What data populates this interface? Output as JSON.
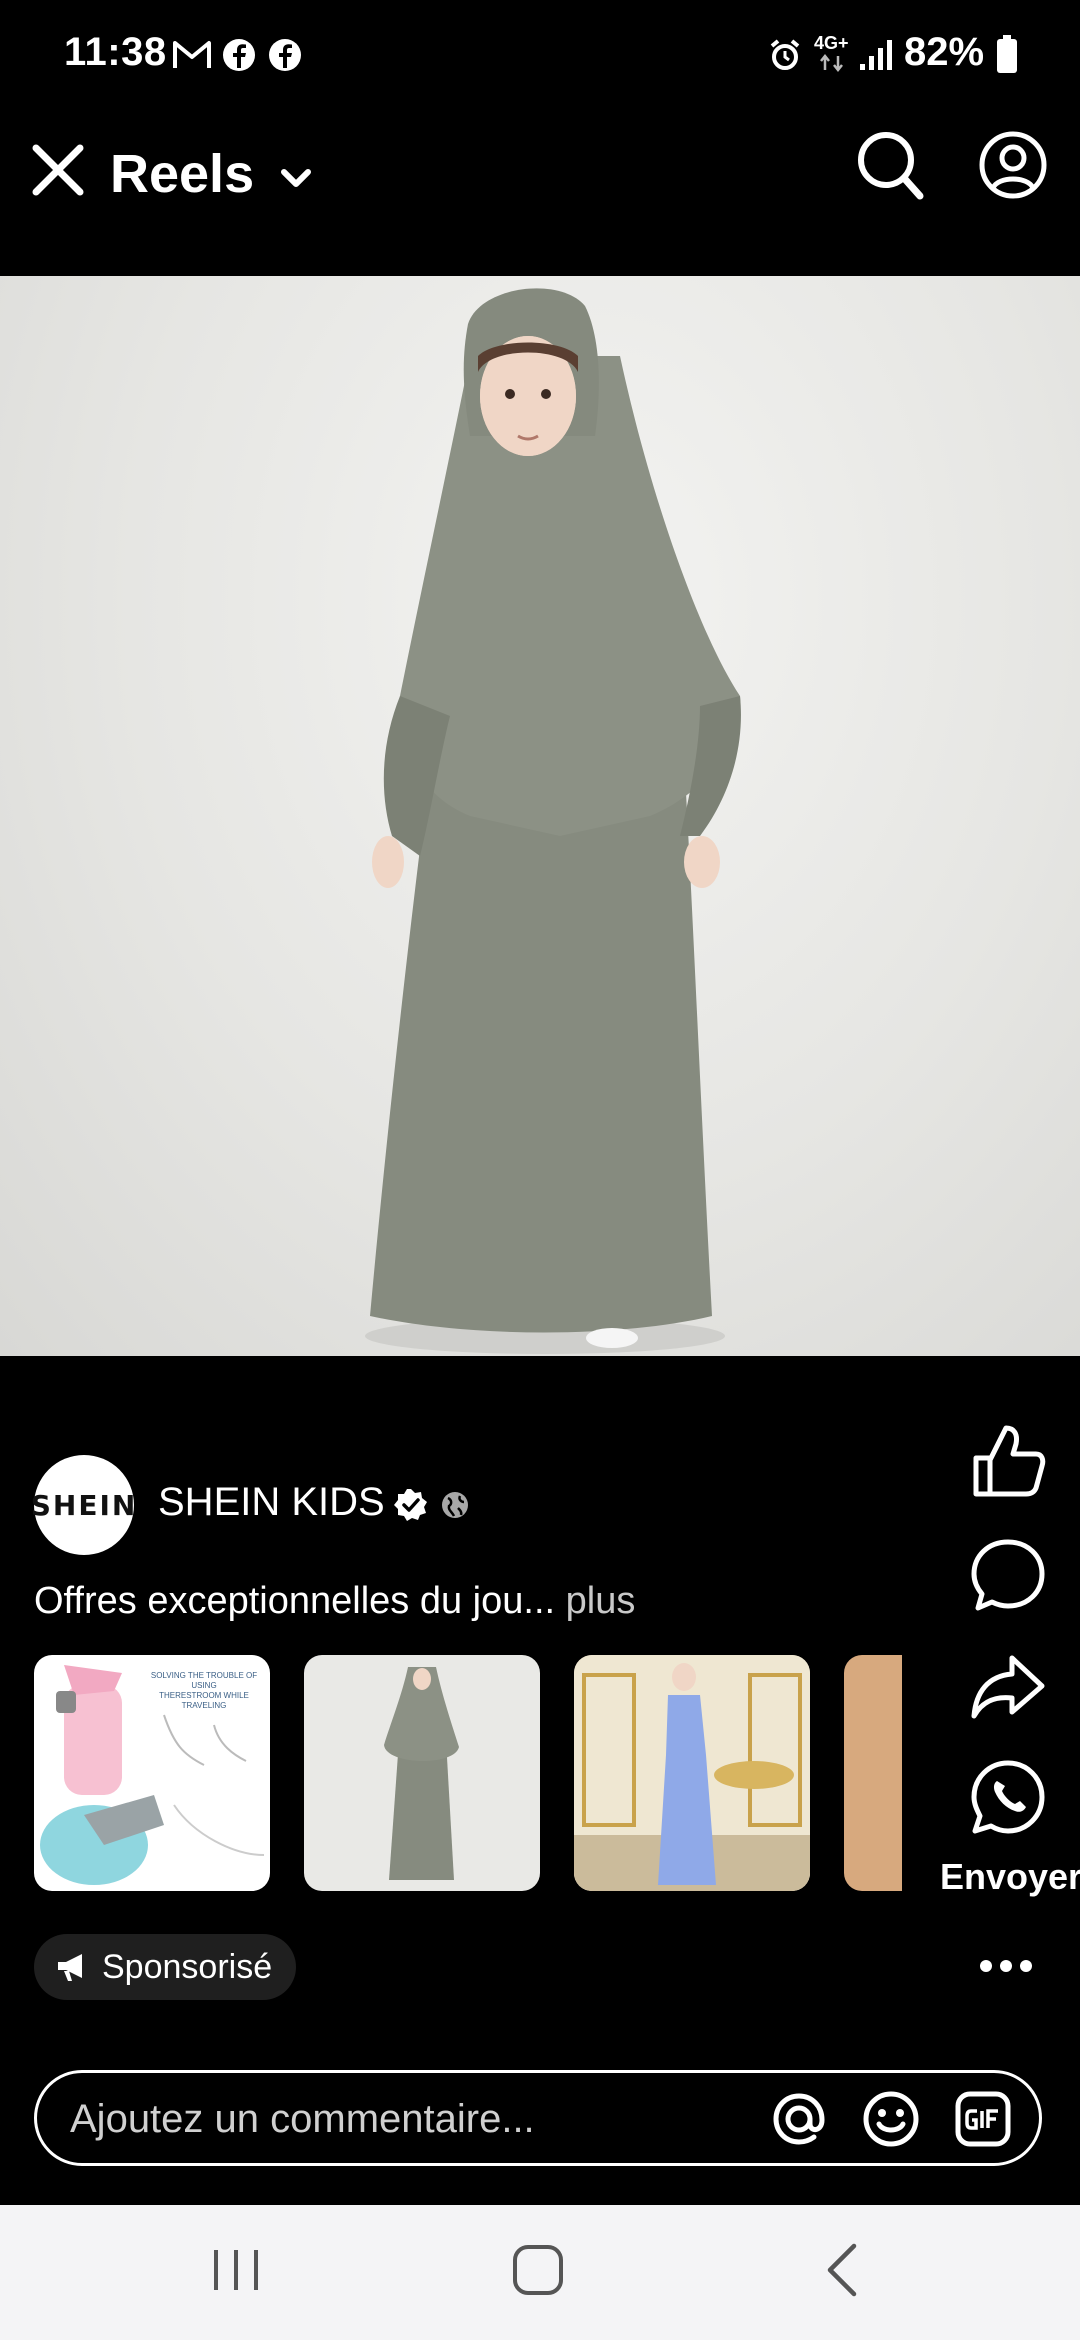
{
  "status": {
    "time": "11:38",
    "network": "4G+",
    "battery": "82%",
    "notification_icons": [
      "gmail-icon",
      "facebook-icon",
      "facebook-icon"
    ]
  },
  "header": {
    "title": "Reels"
  },
  "post": {
    "author": "SHEIN KIDS",
    "avatar_text": "SHEIN",
    "caption": "Offres exceptionnelles du jou...",
    "caption_more": "plus",
    "sponsored": "Sponsorisé",
    "thumb_1_text_line1": "SOLVING THE TROUBLE OF USING",
    "thumb_1_text_line2": "THERESTROOM WHILE TRAVELING"
  },
  "actions": {
    "send_label": "Envoyer"
  },
  "comment": {
    "placeholder": "Ajoutez un commentaire..."
  },
  "colors": {
    "background": "#000000",
    "nav_bar": "#f4f4f6",
    "dress": "#8a8f83",
    "pill": "#1f1f1f"
  }
}
